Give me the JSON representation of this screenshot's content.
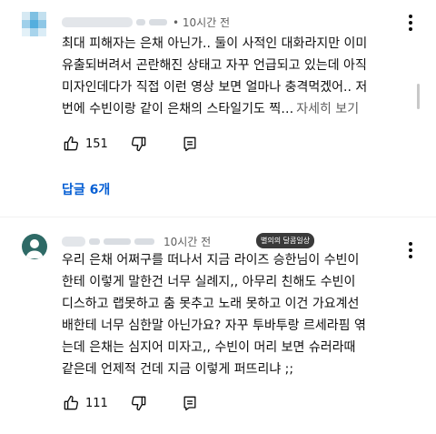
{
  "colors": {
    "link": "#065fd4",
    "secondary_text": "#606060",
    "avatar_bg": "#2e6a66",
    "badge_bg": "#3a3a3a"
  },
  "comments": [
    {
      "time": "• 10시간 전",
      "text_lines": [
        "최대 피해자는 은채 아닌가.. 둘이 사적인 대화라지만 이미",
        "유출되버려서 곤란해진 상태고 자꾸 언급되고 있는데 아직",
        "미자인데다가 직접 이런 영상 보면 얼마나 충격먹겠어.. 저",
        "번에 수빈이랑 같이 은채의 스타일기도 찍…"
      ],
      "more_label": "자세히 보기",
      "like_count": "151",
      "replies_label": "답글 6개",
      "icons": [
        "like-icon",
        "dislike-icon",
        "reply-icon",
        "more-vertical-icon"
      ]
    },
    {
      "time": "10시간 전",
      "badge": "별의의 달콤일상",
      "text_lines": [
        "우리 은채 어쩌구를 떠나서 지금 라이즈 승한님이 수빈이",
        "한테 이렇게 말한건 너무 실례지,, 아무리 친해도 수빈이",
        "디스하고 랩못하고 춤 못추고 노래 못하고 이건 가요계선",
        "배한테 너무 심한말 아닌가요? 자꾸 투바투랑 르세라핌 엮",
        "는데  은채는 심지어 미자고,,  수빈이 머리 보면 슈러라때",
        "같은데 언제적 건데 지금 이렇게 퍼뜨리냐 ;;"
      ],
      "like_count": "111",
      "icons": [
        "like-icon",
        "dislike-icon",
        "reply-icon",
        "more-vertical-icon"
      ]
    }
  ]
}
